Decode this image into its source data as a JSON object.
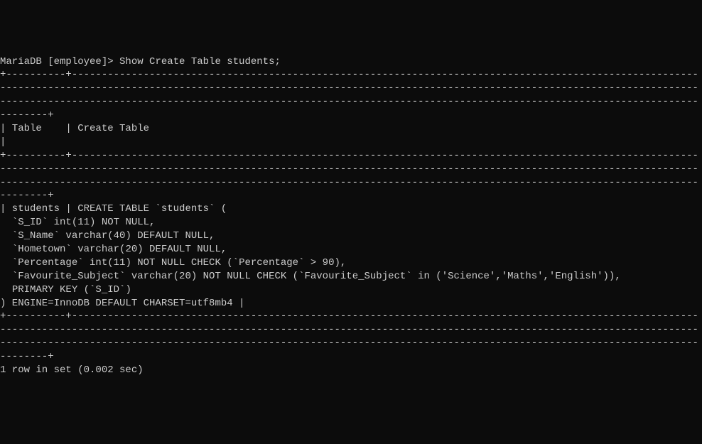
{
  "prompt": "MariaDB [employee]> ",
  "command": "Show Create Table students;",
  "border_top": "+----------+-----------------------------------------------------------------------------------------------------------------------------------------------------------------------------------------------------------------------------------------------------------------------------------------------------------------------------------------------------------+",
  "header_row": "| Table    | Create Table                                                                                                                                                                                                                                                                                                                                              |",
  "border_mid": "+----------+-----------------------------------------------------------------------------------------------------------------------------------------------------------------------------------------------------------------------------------------------------------------------------------------------------------------------------------------------------------+",
  "data_table_name": "| students | ",
  "ct_line1": "CREATE TABLE `students` (",
  "ct_line2": "  `S_ID` int(11) NOT NULL,",
  "ct_line3": "  `S_Name` varchar(40) DEFAULT NULL,",
  "ct_line4": "  `Hometown` varchar(20) DEFAULT NULL,",
  "ct_line5": "  `Percentage` int(11) NOT NULL CHECK (`Percentage` > 90),",
  "ct_line6": "  `Favourite_Subject` varchar(20) NOT NULL CHECK (`Favourite_Subject` in ('Science','Maths','English')),",
  "ct_line7": "  PRIMARY KEY (`S_ID`)",
  "ct_line8": ") ENGINE=InnoDB DEFAULT CHARSET=utf8mb4 |",
  "border_bot": "+----------+-----------------------------------------------------------------------------------------------------------------------------------------------------------------------------------------------------------------------------------------------------------------------------------------------------------------------------------------------------------+",
  "footer": "1 row in set (0.002 sec)"
}
